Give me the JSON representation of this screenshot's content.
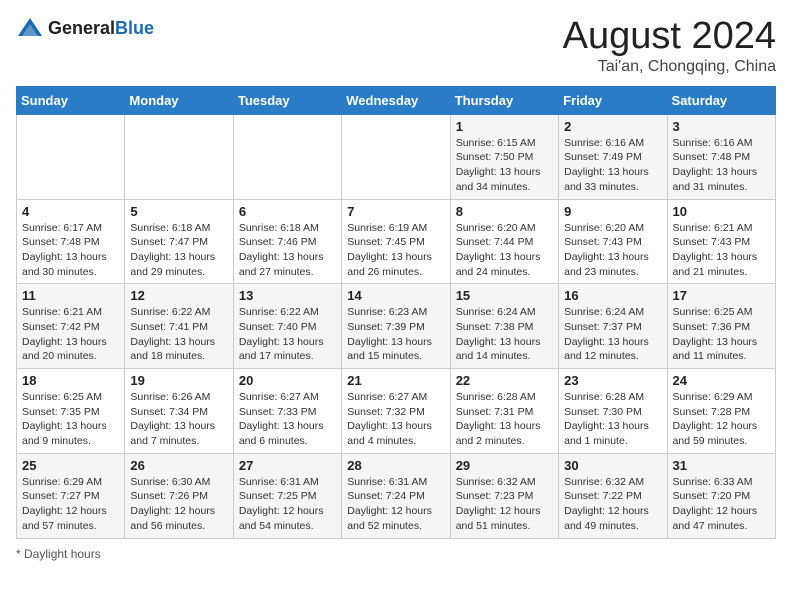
{
  "logo": {
    "general": "General",
    "blue": "Blue"
  },
  "title": "August 2024",
  "subtitle": "Tai'an, Chongqing, China",
  "days_of_week": [
    "Sunday",
    "Monday",
    "Tuesday",
    "Wednesday",
    "Thursday",
    "Friday",
    "Saturday"
  ],
  "footer": "Daylight hours",
  "weeks": [
    [
      {
        "day": "",
        "info": ""
      },
      {
        "day": "",
        "info": ""
      },
      {
        "day": "",
        "info": ""
      },
      {
        "day": "",
        "info": ""
      },
      {
        "day": "1",
        "info": "Sunrise: 6:15 AM\nSunset: 7:50 PM\nDaylight: 13 hours and 34 minutes."
      },
      {
        "day": "2",
        "info": "Sunrise: 6:16 AM\nSunset: 7:49 PM\nDaylight: 13 hours and 33 minutes."
      },
      {
        "day": "3",
        "info": "Sunrise: 6:16 AM\nSunset: 7:48 PM\nDaylight: 13 hours and 31 minutes."
      }
    ],
    [
      {
        "day": "4",
        "info": "Sunrise: 6:17 AM\nSunset: 7:48 PM\nDaylight: 13 hours and 30 minutes."
      },
      {
        "day": "5",
        "info": "Sunrise: 6:18 AM\nSunset: 7:47 PM\nDaylight: 13 hours and 29 minutes."
      },
      {
        "day": "6",
        "info": "Sunrise: 6:18 AM\nSunset: 7:46 PM\nDaylight: 13 hours and 27 minutes."
      },
      {
        "day": "7",
        "info": "Sunrise: 6:19 AM\nSunset: 7:45 PM\nDaylight: 13 hours and 26 minutes."
      },
      {
        "day": "8",
        "info": "Sunrise: 6:20 AM\nSunset: 7:44 PM\nDaylight: 13 hours and 24 minutes."
      },
      {
        "day": "9",
        "info": "Sunrise: 6:20 AM\nSunset: 7:43 PM\nDaylight: 13 hours and 23 minutes."
      },
      {
        "day": "10",
        "info": "Sunrise: 6:21 AM\nSunset: 7:43 PM\nDaylight: 13 hours and 21 minutes."
      }
    ],
    [
      {
        "day": "11",
        "info": "Sunrise: 6:21 AM\nSunset: 7:42 PM\nDaylight: 13 hours and 20 minutes."
      },
      {
        "day": "12",
        "info": "Sunrise: 6:22 AM\nSunset: 7:41 PM\nDaylight: 13 hours and 18 minutes."
      },
      {
        "day": "13",
        "info": "Sunrise: 6:22 AM\nSunset: 7:40 PM\nDaylight: 13 hours and 17 minutes."
      },
      {
        "day": "14",
        "info": "Sunrise: 6:23 AM\nSunset: 7:39 PM\nDaylight: 13 hours and 15 minutes."
      },
      {
        "day": "15",
        "info": "Sunrise: 6:24 AM\nSunset: 7:38 PM\nDaylight: 13 hours and 14 minutes."
      },
      {
        "day": "16",
        "info": "Sunrise: 6:24 AM\nSunset: 7:37 PM\nDaylight: 13 hours and 12 minutes."
      },
      {
        "day": "17",
        "info": "Sunrise: 6:25 AM\nSunset: 7:36 PM\nDaylight: 13 hours and 11 minutes."
      }
    ],
    [
      {
        "day": "18",
        "info": "Sunrise: 6:25 AM\nSunset: 7:35 PM\nDaylight: 13 hours and 9 minutes."
      },
      {
        "day": "19",
        "info": "Sunrise: 6:26 AM\nSunset: 7:34 PM\nDaylight: 13 hours and 7 minutes."
      },
      {
        "day": "20",
        "info": "Sunrise: 6:27 AM\nSunset: 7:33 PM\nDaylight: 13 hours and 6 minutes."
      },
      {
        "day": "21",
        "info": "Sunrise: 6:27 AM\nSunset: 7:32 PM\nDaylight: 13 hours and 4 minutes."
      },
      {
        "day": "22",
        "info": "Sunrise: 6:28 AM\nSunset: 7:31 PM\nDaylight: 13 hours and 2 minutes."
      },
      {
        "day": "23",
        "info": "Sunrise: 6:28 AM\nSunset: 7:30 PM\nDaylight: 13 hours and 1 minute."
      },
      {
        "day": "24",
        "info": "Sunrise: 6:29 AM\nSunset: 7:28 PM\nDaylight: 12 hours and 59 minutes."
      }
    ],
    [
      {
        "day": "25",
        "info": "Sunrise: 6:29 AM\nSunset: 7:27 PM\nDaylight: 12 hours and 57 minutes."
      },
      {
        "day": "26",
        "info": "Sunrise: 6:30 AM\nSunset: 7:26 PM\nDaylight: 12 hours and 56 minutes."
      },
      {
        "day": "27",
        "info": "Sunrise: 6:31 AM\nSunset: 7:25 PM\nDaylight: 12 hours and 54 minutes."
      },
      {
        "day": "28",
        "info": "Sunrise: 6:31 AM\nSunset: 7:24 PM\nDaylight: 12 hours and 52 minutes."
      },
      {
        "day": "29",
        "info": "Sunrise: 6:32 AM\nSunset: 7:23 PM\nDaylight: 12 hours and 51 minutes."
      },
      {
        "day": "30",
        "info": "Sunrise: 6:32 AM\nSunset: 7:22 PM\nDaylight: 12 hours and 49 minutes."
      },
      {
        "day": "31",
        "info": "Sunrise: 6:33 AM\nSunset: 7:20 PM\nDaylight: 12 hours and 47 minutes."
      }
    ]
  ]
}
